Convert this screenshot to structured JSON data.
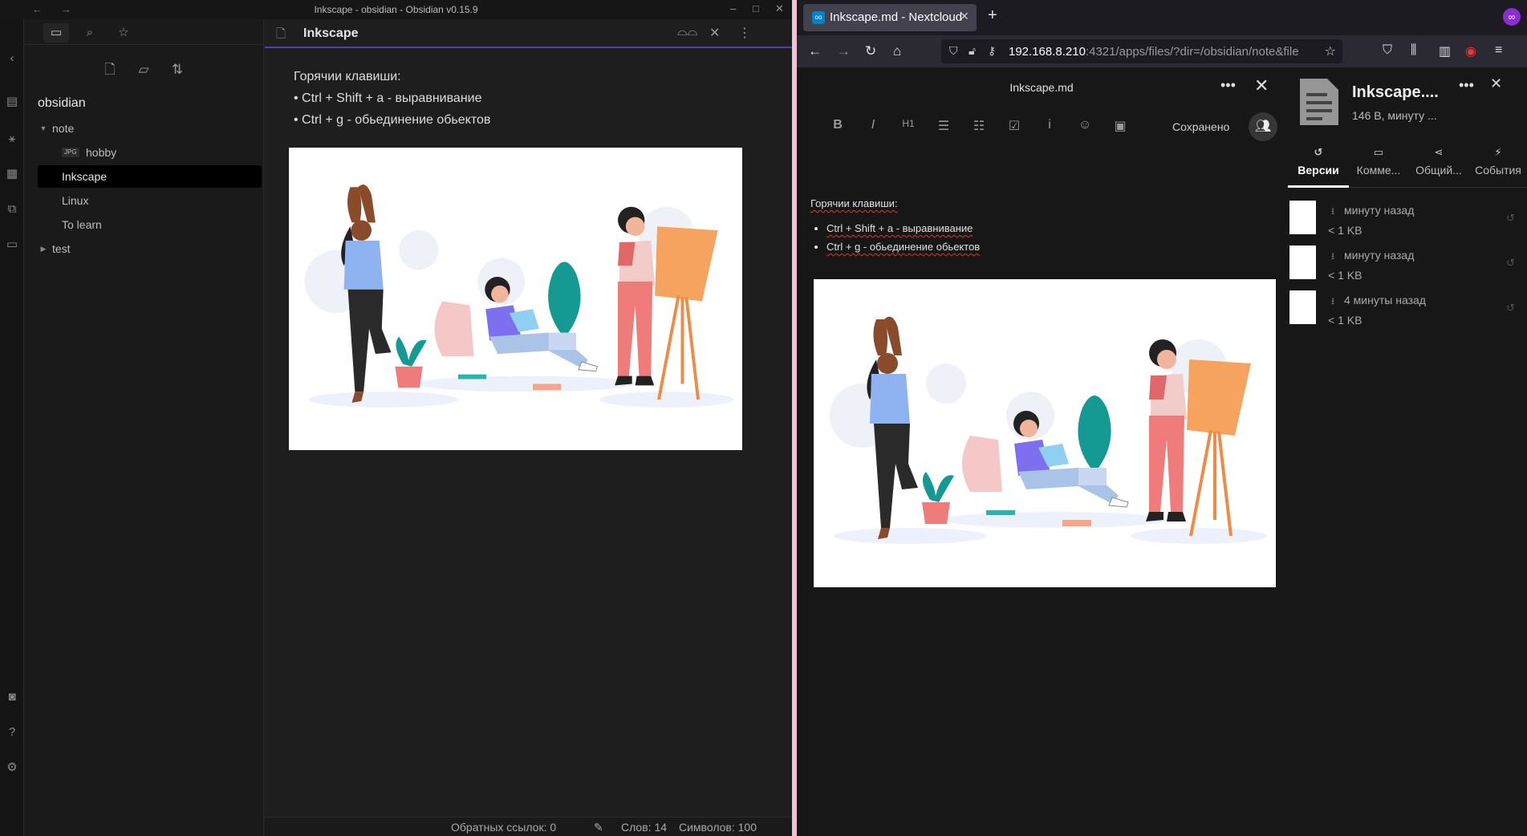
{
  "obsidian": {
    "window_title": "Inkscape - obsidian - Obsidian v0.15.9",
    "vault_name": "obsidian",
    "tree": [
      {
        "label": "note",
        "type": "folder",
        "expanded": true
      },
      {
        "label": "hobby",
        "type": "file",
        "tag": "JPG"
      },
      {
        "label": "Inkscape",
        "type": "file",
        "active": true
      },
      {
        "label": "Linux",
        "type": "file"
      },
      {
        "label": "To learn",
        "type": "file"
      },
      {
        "label": "test",
        "type": "folder",
        "expanded": false
      }
    ],
    "tab_title": "Inkscape",
    "content_lines": [
      "Горячии клавиши:",
      "• Ctrl + Shift + a - выравнивание",
      "• Ctrl + g - обьединение обьектов"
    ],
    "status": {
      "backlinks": "Обратных ссылок: 0",
      "words": "Слов: 14",
      "chars": "Символов: 100"
    },
    "accent_color": "#4f3fa8"
  },
  "firefox": {
    "tab_title": "Inkscape.md - Nextcloud",
    "url_host": "192.168.8.210",
    "url_rest": ":4321/apps/files/?dir=/obsidian/note&file",
    "ext_badge": "∞"
  },
  "nextcloud": {
    "file_name": "Inkscape.md",
    "saved_label": "Сохранено",
    "body_heading": "Горячии клавиши:",
    "body_items": [
      "Ctrl + Shift + a - выравнивание",
      "Ctrl + g - обьединение обьектов"
    ],
    "sidebar": {
      "title": "Inkscape....",
      "subtitle": "146 B, минуту ...",
      "tabs": [
        "Версии",
        "Комме...",
        "Общий...",
        "События"
      ],
      "active_tab": "Версии",
      "versions": [
        {
          "when": "минуту назад",
          "size": "< 1 KB"
        },
        {
          "when": "минуту назад",
          "size": "< 1 KB"
        },
        {
          "when": "4 минуты назад",
          "size": "< 1 KB"
        }
      ]
    }
  }
}
